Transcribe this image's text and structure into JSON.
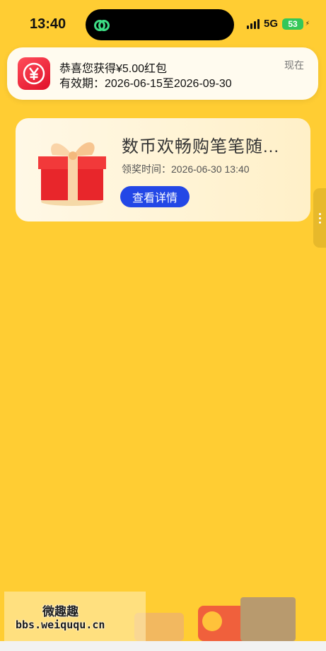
{
  "status_bar": {
    "time": "13:40",
    "network": "5G",
    "battery": "53"
  },
  "notification": {
    "title": "恭喜您获得¥5.00红包",
    "subtitle": "有效期：2026-06-15至2026-09-30",
    "time": "现在"
  },
  "card": {
    "title": "数币欢畅购笔笔随...",
    "time_label": "领奖时间：2026-06-30 13:40",
    "button_label": "查看详情"
  },
  "watermark": {
    "name": "微趣趣",
    "url": "bbs.weiququ.cn"
  },
  "colors": {
    "background": "#FFCD33",
    "button": "#2347E6",
    "app_icon": "#E8192C",
    "battery": "#34C759"
  }
}
